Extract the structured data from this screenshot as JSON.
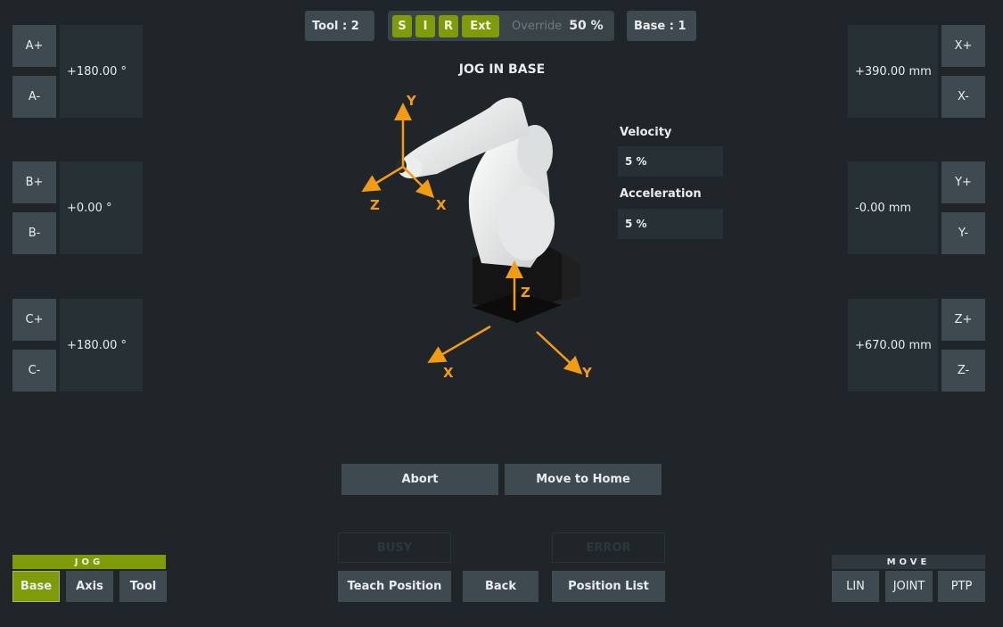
{
  "top_bar": {
    "tool_label": "Tool  : 2",
    "mode_buttons": [
      "S",
      "I",
      "R",
      "Ext"
    ],
    "override_label": "Override",
    "override_value": "50 %",
    "base_label": "Base : 1"
  },
  "view": {
    "title": "JOG IN BASE",
    "tool_axes": {
      "y": "Y",
      "z": "Z",
      "x": "X"
    },
    "base_axes": {
      "z": "Z",
      "x": "X",
      "y": "Y"
    }
  },
  "params": {
    "velocity_label": "Velocity",
    "velocity_value": "5 %",
    "acceleration_label": "Acceleration",
    "acceleration_value": "5 %"
  },
  "left_axes": [
    {
      "plus": "A+",
      "minus": "A-",
      "value": "+180.00 °"
    },
    {
      "plus": "B+",
      "minus": "B-",
      "value": "+0.00 °"
    },
    {
      "plus": "C+",
      "minus": "C-",
      "value": "+180.00 °"
    }
  ],
  "right_axes": [
    {
      "plus": "X+",
      "minus": "X-",
      "value": "+390.00 mm"
    },
    {
      "plus": "Y+",
      "minus": "Y-",
      "value": "-0.00 mm"
    },
    {
      "plus": "Z+",
      "minus": "Z-",
      "value": "+670.00 mm"
    }
  ],
  "actions": {
    "abort": "Abort",
    "move_home": "Move to Home",
    "busy": "BUSY",
    "error": "ERROR",
    "teach_position": "Teach Position",
    "back": "Back",
    "position_list": "Position List"
  },
  "jog": {
    "header": "JOG",
    "options": [
      "Base",
      "Axis",
      "Tool"
    ],
    "selected": "Base"
  },
  "move": {
    "header": "MOVE",
    "options": [
      "LIN",
      "JOINT",
      "PTP"
    ]
  },
  "colors": {
    "accent_green": "#7f9c08",
    "axis_orange": "#f39c12",
    "background": "#1f2528",
    "button": "#3f4a50"
  }
}
